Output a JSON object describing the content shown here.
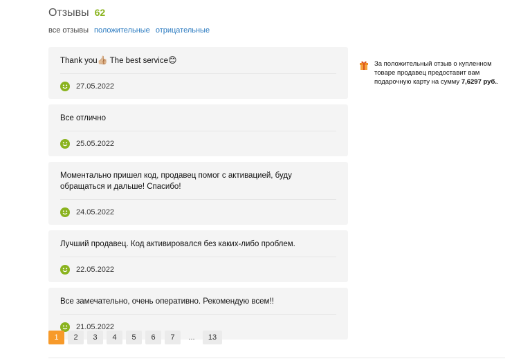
{
  "header": {
    "title": "Отзывы",
    "count": "62"
  },
  "filters": {
    "all": "все отзывы",
    "positive": "положительные",
    "negative": "отрицательные"
  },
  "reviews": [
    {
      "text_before": "Thank you",
      "emoji1": "👍🏼",
      "text_middle": " The best service",
      "emoji2": "😊",
      "date": "27.05.2022",
      "rating_icon": "green-smile-icon"
    },
    {
      "text": "Все отлично",
      "date": "25.05.2022",
      "rating_icon": "green-smile-icon"
    },
    {
      "text": "Моментально пришел код, продавец помог с активацией, буду обращаться и дальше! Спасибо!",
      "date": "24.05.2022",
      "rating_icon": "green-smile-icon"
    },
    {
      "text": "Лучший продавец. Код активировался без каких-либо проблем.",
      "date": "22.05.2022",
      "rating_icon": "green-smile-icon"
    },
    {
      "text": "Все замечательно, очень оперативно. Рекомендую всем!!",
      "date": "21.05.2022",
      "rating_icon": "green-smile-icon"
    }
  ],
  "side_note": {
    "icon": "gift-icon",
    "text_before": "За положительный отзыв о купленном товаре продавец предоставит вам подарочную карту на сумму ",
    "amount": "7,6297 руб.",
    "text_after": "."
  },
  "pagination": {
    "pages": [
      "1",
      "2",
      "3",
      "4",
      "5",
      "6",
      "7"
    ],
    "ellipsis": "...",
    "last": "13",
    "current": "1"
  },
  "colors": {
    "count_green": "#8ab31e",
    "link_blue": "#2a7ac0",
    "current_page_orange": "#f79a2a",
    "review_bg": "#f4f4f4"
  }
}
